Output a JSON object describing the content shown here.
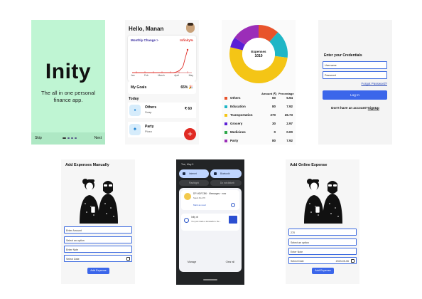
{
  "splash": {
    "logo": "Inity",
    "tagline": "The all in one personal finance app.",
    "skip_label": "Skip",
    "next_label": "Next",
    "colors": {
      "background": "#bff5d3"
    }
  },
  "dashboard": {
    "greeting": "Hello, Manan",
    "chart_title": "Monthly Change >",
    "inflation_label": "Infinity%",
    "months": [
      "Jan",
      "Feb",
      "March",
      "April",
      "May"
    ],
    "goals_label": "My Goals",
    "goals_value": "65% 🎉",
    "today_label": "Today",
    "transactions": [
      {
        "title": "Others",
        "subtitle": "Soap",
        "amount": "₹ 60",
        "icon": "cart-icon"
      },
      {
        "title": "Party",
        "subtitle": "Pizza",
        "amount": "",
        "icon": "party-icon"
      }
    ],
    "fab_label": "+"
  },
  "expense_chart": {
    "center_title": "Expenses",
    "center_value": "1010",
    "amount_header": "Amount (₹)",
    "percentage_header": "Percentage"
  },
  "chart_data": {
    "type": "pie",
    "title": "Expenses",
    "total": 1010,
    "slices": [
      {
        "name": "Others",
        "amount": 60,
        "percent": 5.94,
        "color": "#e8532b"
      },
      {
        "name": "Education",
        "amount": 80,
        "percent": 7.92,
        "color": "#1fb6c6"
      },
      {
        "name": "Transportation",
        "amount": 270,
        "percent": 26.73,
        "color": "#f4c516"
      },
      {
        "name": "Grocery",
        "amount": 30,
        "percent": 2.97,
        "color": "#5b1fd6"
      },
      {
        "name": "Medicines",
        "amount": 0,
        "percent": 0.0,
        "color": "#2ea84a"
      },
      {
        "name": "Party",
        "amount": 80,
        "percent": 7.92,
        "color": "#9b2db8"
      }
    ],
    "amounts_display": [
      "60",
      "80",
      "270",
      "30",
      "0",
      "80"
    ],
    "percents_display": [
      "5.94",
      "7.92",
      "26.73",
      "2.97",
      "0.00",
      "7.92"
    ]
  },
  "login": {
    "heading": "Enter your Credentials",
    "username_placeholder": "Username",
    "password_placeholder": "Password",
    "forgot_label": "Forgot Password?",
    "login_label": "Log In",
    "no_account_text": "Don't have an account?",
    "signup_label": "SignUp"
  },
  "manual_expense": {
    "title": "Add Expenses Manually",
    "fields": [
      "Enter Amount",
      "Select an option",
      "Enter Note",
      "Select Date"
    ],
    "button_label": "Add Expense"
  },
  "notifications": {
    "status_time": "Tue, May 9",
    "tiles": [
      "Internet",
      "Bluetooth",
      "Flashlight",
      "Do not disturb"
    ],
    "notification_1": {
      "title": "DP-HDFCBK · Messages · now",
      "body": "Spent Rs.270",
      "action": "Mark as read"
    },
    "notification_2": {
      "title": "Inity ⊕",
      "body": "You just made a transaction. Re..."
    },
    "manage_label": "Manage",
    "clear_label": "Clear all"
  },
  "online_expense": {
    "title": "Add Online Expense",
    "fields": [
      "270",
      "Select an option",
      "Enter Note",
      "Select Date"
    ],
    "date_value": "2023-05-06",
    "button_label": "Add Expense"
  }
}
